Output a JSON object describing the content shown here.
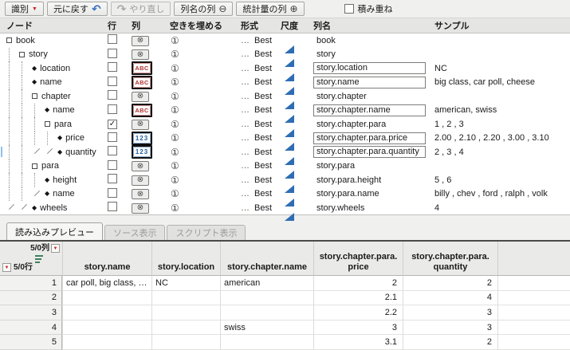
{
  "colors": {
    "abc_red": "#b03030",
    "num_blue": "#1f5fa0",
    "continuous_blue": "#2e6db4",
    "marker_red": "#cc2222",
    "undo_blue": "#3a6fc0"
  },
  "icons": {
    "dropdown_caret": "▼",
    "undo_arrow": "↶",
    "redo_arrow": "↷",
    "minus_circle": "⊖",
    "plus_circle": "⊕",
    "excluded_column": "⊗",
    "fill_one": "①",
    "checkmark": "✓",
    "diamond": "◆",
    "abc": "ABC",
    "num": "123",
    "format_ellipsis": "…"
  },
  "toolbar": {
    "identify_label": "識別",
    "undo_label": "元に戻す",
    "redo_label": "やり直し",
    "colname_col_label": "列名の列",
    "stats_col_label": "統計量の列",
    "stack_label": "積み重ね",
    "stack_checked": false
  },
  "tree": {
    "headers": {
      "node": "ノード",
      "row": "行",
      "col": "列",
      "fill": "空きを埋める",
      "format": "形式",
      "scale": "尺度",
      "colname": "列名",
      "sample": "サンプル"
    },
    "rows": [
      {
        "label": "book",
        "type": "container",
        "guides": [],
        "checked": false,
        "col_type": "excluded",
        "format": "Best",
        "column_name": "book",
        "name_box": false,
        "sample": "",
        "selected": false
      },
      {
        "label": "story",
        "type": "container",
        "guides": [
          "g"
        ],
        "checked": false,
        "col_type": "excluded",
        "format": "Best",
        "column_name": "story",
        "name_box": false,
        "sample": "",
        "selected": false
      },
      {
        "label": "location",
        "type": "leaf",
        "guides": [
          "g",
          "g"
        ],
        "checked": false,
        "col_type": "abc",
        "format": "Best",
        "column_name": "story.location",
        "name_box": true,
        "sample": "NC",
        "selected": false
      },
      {
        "label": "name",
        "type": "leaf",
        "guides": [
          "g",
          "g"
        ],
        "checked": false,
        "col_type": "abc",
        "format": "Best",
        "column_name": "story.name",
        "name_box": true,
        "sample": "big class, car poll, cheese",
        "selected": false
      },
      {
        "label": "chapter",
        "type": "container",
        "guides": [
          "g",
          "g"
        ],
        "checked": false,
        "col_type": "excluded",
        "format": "Best",
        "column_name": "story.chapter",
        "name_box": false,
        "sample": "",
        "selected": false
      },
      {
        "label": "name",
        "type": "leaf",
        "guides": [
          "g",
          "g",
          "g"
        ],
        "checked": false,
        "col_type": "abc",
        "format": "Best",
        "column_name": "story.chapter.name",
        "name_box": true,
        "sample": "american, swiss",
        "selected": false
      },
      {
        "label": "para",
        "type": "container",
        "guides": [
          "g",
          "g",
          "g"
        ],
        "checked": true,
        "col_type": "excluded",
        "format": "Best",
        "column_name": "story.chapter.para",
        "name_box": false,
        "sample": "1 , 2 , 3",
        "selected": false
      },
      {
        "label": "price",
        "type": "leaf",
        "guides": [
          "g",
          "g",
          "g",
          "g"
        ],
        "checked": false,
        "col_type": "num",
        "format": "Best",
        "column_name": "story.chapter.para.price",
        "name_box": true,
        "sample": "2.00 , 2.10 , 2.20 , 3.00 , 3.10",
        "selected": false
      },
      {
        "label": "quantity",
        "type": "leaf",
        "guides": [
          "g",
          "g",
          "c",
          "c"
        ],
        "checked": false,
        "col_type": "num",
        "format": "Best",
        "column_name": "story.chapter.para.quantity",
        "name_box": true,
        "sample": "2 , 3 , 4",
        "selected": true
      },
      {
        "label": "para",
        "type": "container",
        "guides": [
          "g",
          "g"
        ],
        "checked": false,
        "col_type": "excluded",
        "format": "Best",
        "column_name": "story.para",
        "name_box": false,
        "sample": "",
        "selected": false
      },
      {
        "label": "height",
        "type": "leaf",
        "guides": [
          "g",
          "g",
          "g"
        ],
        "checked": false,
        "col_type": "excluded",
        "format": "Best",
        "column_name": "story.para.height",
        "name_box": false,
        "sample": "5 , 6",
        "selected": false
      },
      {
        "label": "name",
        "type": "leaf",
        "guides": [
          "g",
          "g",
          "c"
        ],
        "checked": false,
        "col_type": "excluded",
        "format": "Best",
        "column_name": "story.para.name",
        "name_box": false,
        "sample": "billy , chev , ford , ralph , volk",
        "selected": false
      },
      {
        "label": "wheels",
        "type": "leaf",
        "guides": [
          "c",
          "c"
        ],
        "checked": false,
        "col_type": "excluded",
        "format": "Best",
        "column_name": "story.wheels",
        "name_box": false,
        "sample": "4",
        "selected": false
      }
    ]
  },
  "tabs": [
    {
      "name": "tab-import-preview",
      "label": "読み込みプレビュー",
      "active": true
    },
    {
      "name": "tab-source-view",
      "label": "ソース表示",
      "active": false
    },
    {
      "name": "tab-script-view",
      "label": "スクリプト表示",
      "active": false
    }
  ],
  "preview": {
    "corner": {
      "cols_label": "5/0列",
      "rows_label": "5/0行"
    },
    "columns": [
      {
        "lines": [
          "story.name"
        ]
      },
      {
        "lines": [
          "story.location"
        ]
      },
      {
        "lines": [
          "story.chapter.name"
        ]
      },
      {
        "lines": [
          "story.chapter.para.",
          "price"
        ]
      },
      {
        "lines": [
          "story.chapter.para.",
          "quantity"
        ]
      }
    ],
    "rows": [
      {
        "num": "1",
        "cells": [
          "car poll, big class, …",
          "NC",
          "american",
          "2",
          "2"
        ]
      },
      {
        "num": "2",
        "cells": [
          "",
          "",
          "",
          "2.1",
          "4"
        ]
      },
      {
        "num": "3",
        "cells": [
          "",
          "",
          "",
          "2.2",
          "3"
        ]
      },
      {
        "num": "4",
        "cells": [
          "",
          "",
          "swiss",
          "3",
          "3"
        ]
      },
      {
        "num": "5",
        "cells": [
          "",
          "",
          "",
          "3.1",
          "2"
        ]
      }
    ]
  }
}
